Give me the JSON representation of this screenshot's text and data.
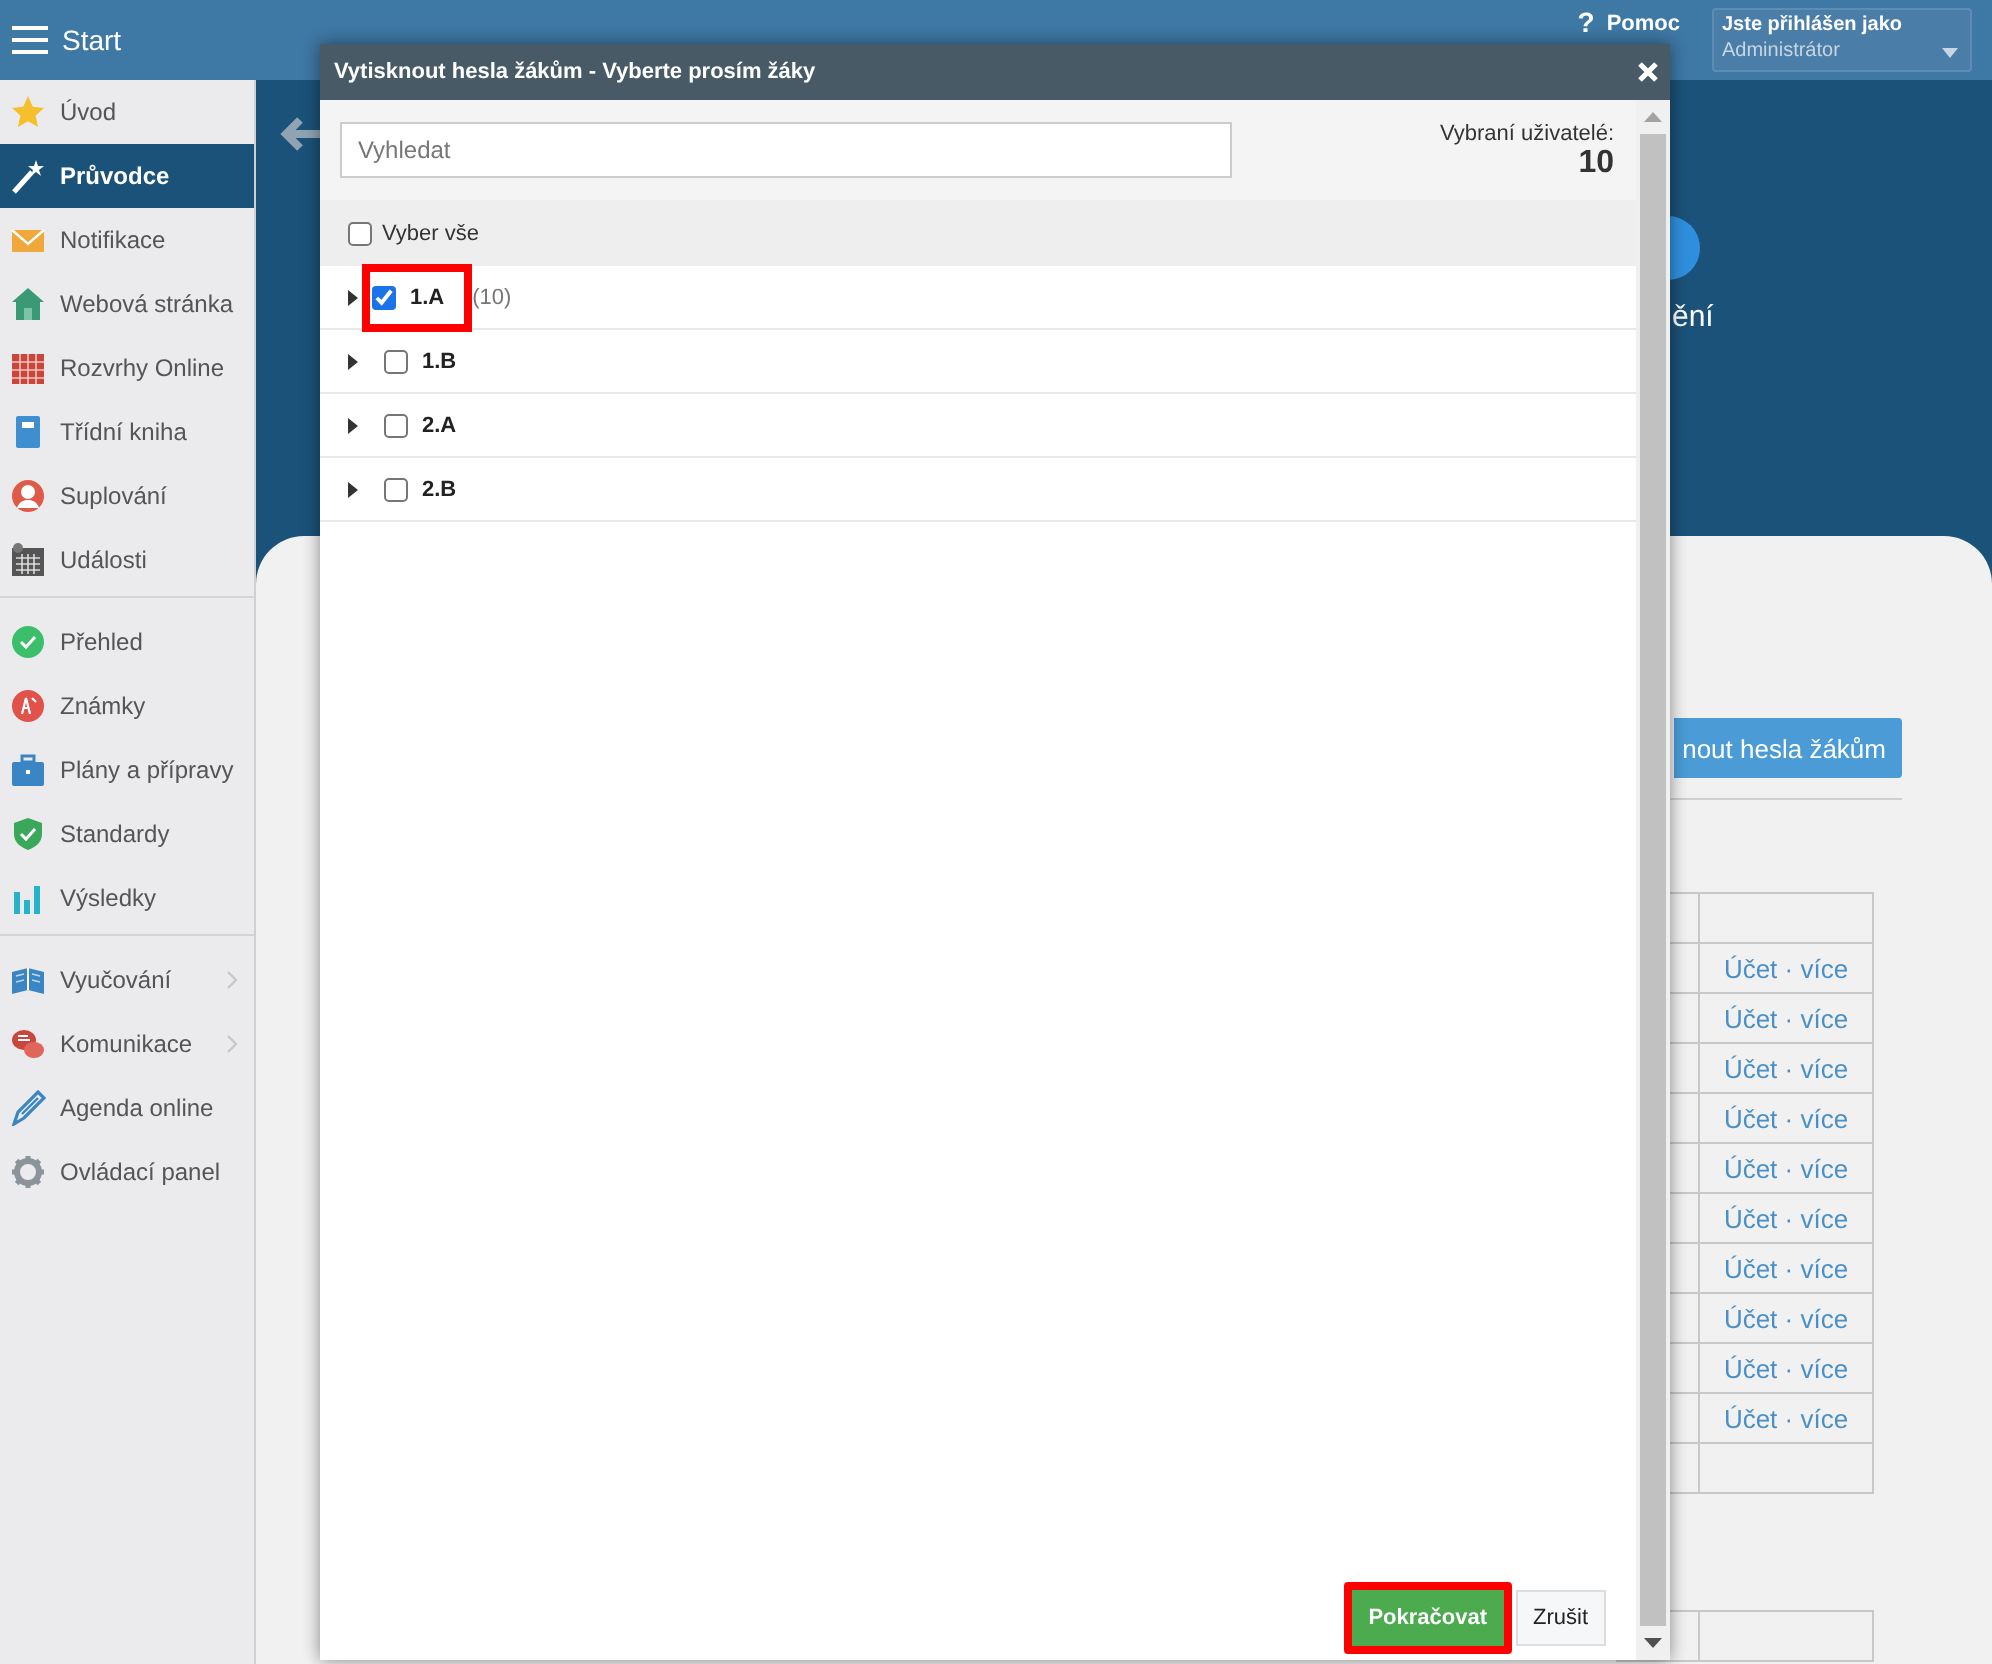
{
  "header": {
    "menu_label": "Start",
    "help_icon": "?",
    "help_label": "Pomoc",
    "user": {
      "caption": "Jste přihlášen jako",
      "name": "Administrátor"
    }
  },
  "sidebar": {
    "groups": [
      [
        {
          "label": "Úvod",
          "selected": false,
          "has_submenu": false
        },
        {
          "label": "Průvodce",
          "selected": true,
          "has_submenu": false
        },
        {
          "label": "Notifikace",
          "selected": false,
          "has_submenu": false
        },
        {
          "label": "Webová stránka",
          "selected": false,
          "has_submenu": false
        },
        {
          "label": "Rozvrhy Online",
          "selected": false,
          "has_submenu": false
        },
        {
          "label": "Třídní kniha",
          "selected": false,
          "has_submenu": false
        },
        {
          "label": "Suplování",
          "selected": false,
          "has_submenu": false
        },
        {
          "label": "Události",
          "selected": false,
          "has_submenu": false
        }
      ],
      [
        {
          "label": "Přehled",
          "selected": false,
          "has_submenu": false
        },
        {
          "label": "Známky",
          "selected": false,
          "has_submenu": false
        },
        {
          "label": "Plány a přípravy",
          "selected": false,
          "has_submenu": false
        },
        {
          "label": "Standardy",
          "selected": false,
          "has_submenu": false
        },
        {
          "label": "Výsledky",
          "selected": false,
          "has_submenu": false
        }
      ],
      [
        {
          "label": "Vyučování",
          "selected": false,
          "has_submenu": true
        },
        {
          "label": "Komunikace",
          "selected": false,
          "has_submenu": true
        },
        {
          "label": "Agenda online",
          "selected": false,
          "has_submenu": false
        },
        {
          "label": "Ovládací panel",
          "selected": false,
          "has_submenu": false
        }
      ]
    ]
  },
  "background": {
    "feature_label": "ění",
    "action_button": "nout hesla žákům",
    "table": {
      "rows": [
        {
          "column_2": "Účet · více"
        },
        {
          "column_2": "Účet · více"
        },
        {
          "column_2": "Účet · více"
        },
        {
          "column_2": "Účet · více"
        },
        {
          "column_2": "Účet · více"
        },
        {
          "column_2": "Účet · více"
        },
        {
          "column_2": "Účet · více"
        },
        {
          "column_2": "Účet · více"
        },
        {
          "column_2": "Účet · více"
        },
        {
          "column_2": "Účet · více"
        },
        {}
      ]
    }
  },
  "dialog": {
    "title": "Vytisknout hesla žákům - Vyberte prosím žáky",
    "search": {
      "placeholder": "Vyhledat"
    },
    "selected_label": "Vybraní uživatelé:",
    "selected_count": "10",
    "select_all": {
      "label": "Vyber vše",
      "checked": false
    },
    "classes": [
      {
        "label": "1.A",
        "count": "(10)",
        "checked": true,
        "expanded": false,
        "highlighted": true
      },
      {
        "label": "1.B",
        "checked": false,
        "expanded": false,
        "highlighted": false
      },
      {
        "label": "2.A",
        "checked": false,
        "expanded": false,
        "highlighted": false
      },
      {
        "label": "2.B",
        "checked": false,
        "expanded": false,
        "highlighted": false
      }
    ],
    "buttons": [
      {
        "label": "Pokračovat",
        "kind": "primary",
        "highlighted": true
      },
      {
        "label": "Zrušit",
        "kind": "default",
        "highlighted": false
      }
    ]
  }
}
